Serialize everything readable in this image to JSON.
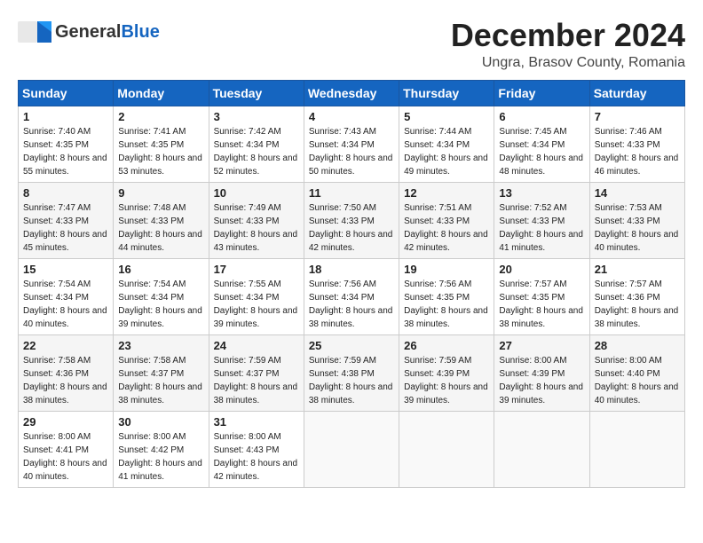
{
  "header": {
    "logo_general": "General",
    "logo_blue": "Blue",
    "month_title": "December 2024",
    "location": "Ungra, Brasov County, Romania"
  },
  "days_of_week": [
    "Sunday",
    "Monday",
    "Tuesday",
    "Wednesday",
    "Thursday",
    "Friday",
    "Saturday"
  ],
  "weeks": [
    [
      {
        "day": "1",
        "sunrise": "Sunrise: 7:40 AM",
        "sunset": "Sunset: 4:35 PM",
        "daylight": "Daylight: 8 hours and 55 minutes."
      },
      {
        "day": "2",
        "sunrise": "Sunrise: 7:41 AM",
        "sunset": "Sunset: 4:35 PM",
        "daylight": "Daylight: 8 hours and 53 minutes."
      },
      {
        "day": "3",
        "sunrise": "Sunrise: 7:42 AM",
        "sunset": "Sunset: 4:34 PM",
        "daylight": "Daylight: 8 hours and 52 minutes."
      },
      {
        "day": "4",
        "sunrise": "Sunrise: 7:43 AM",
        "sunset": "Sunset: 4:34 PM",
        "daylight": "Daylight: 8 hours and 50 minutes."
      },
      {
        "day": "5",
        "sunrise": "Sunrise: 7:44 AM",
        "sunset": "Sunset: 4:34 PM",
        "daylight": "Daylight: 8 hours and 49 minutes."
      },
      {
        "day": "6",
        "sunrise": "Sunrise: 7:45 AM",
        "sunset": "Sunset: 4:34 PM",
        "daylight": "Daylight: 8 hours and 48 minutes."
      },
      {
        "day": "7",
        "sunrise": "Sunrise: 7:46 AM",
        "sunset": "Sunset: 4:33 PM",
        "daylight": "Daylight: 8 hours and 46 minutes."
      }
    ],
    [
      {
        "day": "8",
        "sunrise": "Sunrise: 7:47 AM",
        "sunset": "Sunset: 4:33 PM",
        "daylight": "Daylight: 8 hours and 45 minutes."
      },
      {
        "day": "9",
        "sunrise": "Sunrise: 7:48 AM",
        "sunset": "Sunset: 4:33 PM",
        "daylight": "Daylight: 8 hours and 44 minutes."
      },
      {
        "day": "10",
        "sunrise": "Sunrise: 7:49 AM",
        "sunset": "Sunset: 4:33 PM",
        "daylight": "Daylight: 8 hours and 43 minutes."
      },
      {
        "day": "11",
        "sunrise": "Sunrise: 7:50 AM",
        "sunset": "Sunset: 4:33 PM",
        "daylight": "Daylight: 8 hours and 42 minutes."
      },
      {
        "day": "12",
        "sunrise": "Sunrise: 7:51 AM",
        "sunset": "Sunset: 4:33 PM",
        "daylight": "Daylight: 8 hours and 42 minutes."
      },
      {
        "day": "13",
        "sunrise": "Sunrise: 7:52 AM",
        "sunset": "Sunset: 4:33 PM",
        "daylight": "Daylight: 8 hours and 41 minutes."
      },
      {
        "day": "14",
        "sunrise": "Sunrise: 7:53 AM",
        "sunset": "Sunset: 4:33 PM",
        "daylight": "Daylight: 8 hours and 40 minutes."
      }
    ],
    [
      {
        "day": "15",
        "sunrise": "Sunrise: 7:54 AM",
        "sunset": "Sunset: 4:34 PM",
        "daylight": "Daylight: 8 hours and 40 minutes."
      },
      {
        "day": "16",
        "sunrise": "Sunrise: 7:54 AM",
        "sunset": "Sunset: 4:34 PM",
        "daylight": "Daylight: 8 hours and 39 minutes."
      },
      {
        "day": "17",
        "sunrise": "Sunrise: 7:55 AM",
        "sunset": "Sunset: 4:34 PM",
        "daylight": "Daylight: 8 hours and 39 minutes."
      },
      {
        "day": "18",
        "sunrise": "Sunrise: 7:56 AM",
        "sunset": "Sunset: 4:34 PM",
        "daylight": "Daylight: 8 hours and 38 minutes."
      },
      {
        "day": "19",
        "sunrise": "Sunrise: 7:56 AM",
        "sunset": "Sunset: 4:35 PM",
        "daylight": "Daylight: 8 hours and 38 minutes."
      },
      {
        "day": "20",
        "sunrise": "Sunrise: 7:57 AM",
        "sunset": "Sunset: 4:35 PM",
        "daylight": "Daylight: 8 hours and 38 minutes."
      },
      {
        "day": "21",
        "sunrise": "Sunrise: 7:57 AM",
        "sunset": "Sunset: 4:36 PM",
        "daylight": "Daylight: 8 hours and 38 minutes."
      }
    ],
    [
      {
        "day": "22",
        "sunrise": "Sunrise: 7:58 AM",
        "sunset": "Sunset: 4:36 PM",
        "daylight": "Daylight: 8 hours and 38 minutes."
      },
      {
        "day": "23",
        "sunrise": "Sunrise: 7:58 AM",
        "sunset": "Sunset: 4:37 PM",
        "daylight": "Daylight: 8 hours and 38 minutes."
      },
      {
        "day": "24",
        "sunrise": "Sunrise: 7:59 AM",
        "sunset": "Sunset: 4:37 PM",
        "daylight": "Daylight: 8 hours and 38 minutes."
      },
      {
        "day": "25",
        "sunrise": "Sunrise: 7:59 AM",
        "sunset": "Sunset: 4:38 PM",
        "daylight": "Daylight: 8 hours and 38 minutes."
      },
      {
        "day": "26",
        "sunrise": "Sunrise: 7:59 AM",
        "sunset": "Sunset: 4:39 PM",
        "daylight": "Daylight: 8 hours and 39 minutes."
      },
      {
        "day": "27",
        "sunrise": "Sunrise: 8:00 AM",
        "sunset": "Sunset: 4:39 PM",
        "daylight": "Daylight: 8 hours and 39 minutes."
      },
      {
        "day": "28",
        "sunrise": "Sunrise: 8:00 AM",
        "sunset": "Sunset: 4:40 PM",
        "daylight": "Daylight: 8 hours and 40 minutes."
      }
    ],
    [
      {
        "day": "29",
        "sunrise": "Sunrise: 8:00 AM",
        "sunset": "Sunset: 4:41 PM",
        "daylight": "Daylight: 8 hours and 40 minutes."
      },
      {
        "day": "30",
        "sunrise": "Sunrise: 8:00 AM",
        "sunset": "Sunset: 4:42 PM",
        "daylight": "Daylight: 8 hours and 41 minutes."
      },
      {
        "day": "31",
        "sunrise": "Sunrise: 8:00 AM",
        "sunset": "Sunset: 4:43 PM",
        "daylight": "Daylight: 8 hours and 42 minutes."
      },
      null,
      null,
      null,
      null
    ]
  ]
}
